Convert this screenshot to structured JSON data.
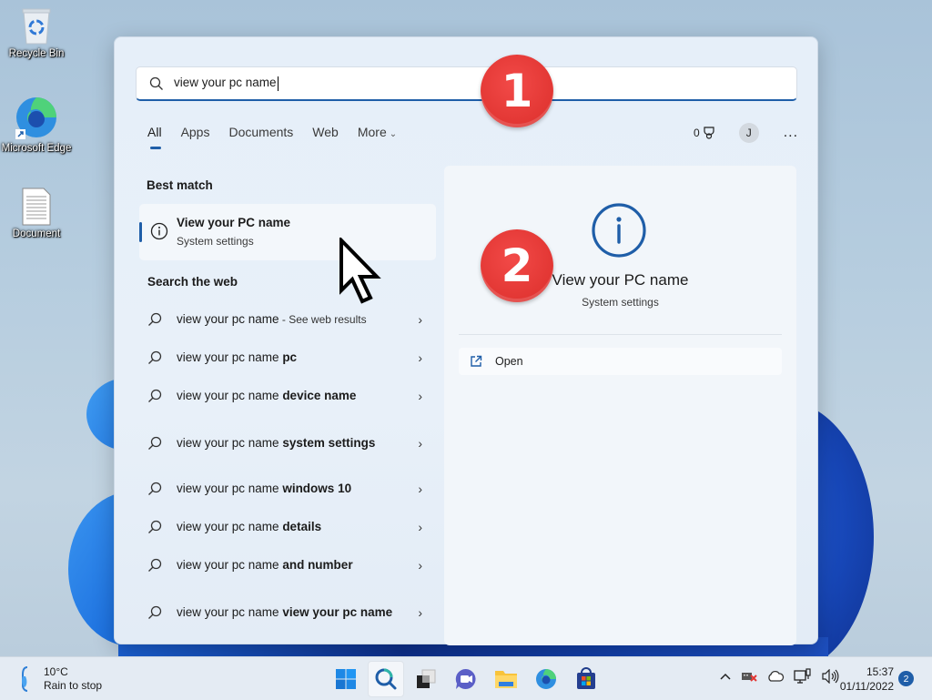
{
  "desktop": {
    "icons": [
      {
        "label": "Recycle Bin",
        "icon": "recycle-bin-icon"
      },
      {
        "label": "Microsoft Edge",
        "icon": "edge-icon"
      },
      {
        "label": "Document",
        "icon": "document-icon"
      }
    ]
  },
  "search": {
    "query": "view your pc name",
    "icon": "search-icon"
  },
  "tabs": [
    {
      "label": "All",
      "active": true
    },
    {
      "label": "Apps",
      "active": false
    },
    {
      "label": "Documents",
      "active": false
    },
    {
      "label": "Web",
      "active": false
    },
    {
      "label": "More",
      "active": false,
      "has_dropdown": true
    }
  ],
  "header_right": {
    "rewards_points": "0",
    "rewards_icon": "trophy-icon",
    "avatar_initial": "J",
    "more_label": "..."
  },
  "best_match": {
    "section_label": "Best match",
    "title": "View your PC name",
    "subtitle": "System settings",
    "icon": "info-icon"
  },
  "search_web": {
    "section_label": "Search the web",
    "items": [
      {
        "prefix": "view your pc name",
        "suffix": "",
        "note": " - See web results"
      },
      {
        "prefix": "view your pc name ",
        "suffix": "pc",
        "note": ""
      },
      {
        "prefix": "view your pc name ",
        "suffix": "device name",
        "note": ""
      },
      {
        "prefix": "view your pc name ",
        "suffix": "system settings",
        "note": ""
      },
      {
        "prefix": "view your pc name ",
        "suffix": "windows 10",
        "note": ""
      },
      {
        "prefix": "view your pc name ",
        "suffix": "details",
        "note": ""
      },
      {
        "prefix": "view your pc name ",
        "suffix": "and number",
        "note": ""
      },
      {
        "prefix": "view your pc name ",
        "suffix": "view your pc name",
        "note": ""
      }
    ]
  },
  "detail": {
    "title": "View your PC name",
    "subtitle": "System settings",
    "icon": "info-icon",
    "actions": [
      {
        "label": "Open",
        "icon": "open-external-icon"
      }
    ]
  },
  "annotations": [
    {
      "number": "1",
      "color": "#e23633"
    },
    {
      "number": "2",
      "color": "#e23633"
    }
  ],
  "taskbar": {
    "weather": {
      "temp": "10°C",
      "condition": "Rain to stop",
      "icon": "umbrella-icon"
    },
    "apps": [
      {
        "name": "Start",
        "icon": "windows-start-icon"
      },
      {
        "name": "Search",
        "icon": "search-icon",
        "active": true
      },
      {
        "name": "Task View",
        "icon": "task-view-icon"
      },
      {
        "name": "Chat",
        "icon": "teams-chat-icon"
      },
      {
        "name": "File Explorer",
        "icon": "folder-icon"
      },
      {
        "name": "Microsoft Edge",
        "icon": "edge-icon"
      },
      {
        "name": "Microsoft Store",
        "icon": "store-icon"
      }
    ],
    "tray": [
      "chevron-up-icon",
      "network-error-icon",
      "onedrive-icon",
      "display-network-icon",
      "speaker-icon"
    ],
    "time": "15:37",
    "date": "01/11/2022",
    "notifications": "2"
  },
  "colors": {
    "accent": "#1f5ea8",
    "annotation_red": "#e23633"
  }
}
